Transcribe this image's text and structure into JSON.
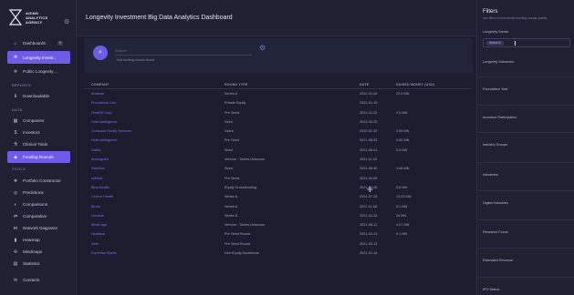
{
  "brand": {
    "name": "AGING ANALYTICS AGENCY"
  },
  "sidebar": {
    "top_items": [
      {
        "label": "Dashboards",
        "badge": "0"
      },
      {
        "label": "Longevity Invest..."
      },
      {
        "label": "Public Longevity ..."
      }
    ],
    "sections": {
      "reports": "REPORTS",
      "data": "DATA",
      "tools": "TOOLS"
    },
    "reports_items": [
      {
        "label": "Downloadable"
      }
    ],
    "data_items": [
      {
        "label": "Companies"
      },
      {
        "label": "Investors"
      },
      {
        "label": "Clinical Trials"
      },
      {
        "label": "Funding Rounds"
      }
    ],
    "tools_items": [
      {
        "label": "Portfolio Constructor"
      },
      {
        "label": "Predictions"
      },
      {
        "label": "Comparisons"
      },
      {
        "label": "Comparative"
      },
      {
        "label": "Network Diagrams"
      },
      {
        "label": "Heatmap"
      },
      {
        "label": "Mindmaps"
      },
      {
        "label": "Statistics"
      }
    ],
    "bottom_item": {
      "label": "Contacts"
    }
  },
  "header": {
    "title": "Longevity Investment Big Data Analytics Dashboard"
  },
  "search": {
    "placeholder": "Search",
    "hint": "Edit funding rounds found"
  },
  "table": {
    "columns": [
      "COMPANY",
      "ROUND TYPE",
      "DATE",
      "RAISED MONEY (USD)"
    ],
    "rows": [
      [
        "Andante",
        "Series A",
        "2022-01-04",
        "22.9 MN"
      ],
      [
        "Providence Gen",
        "Private Equity",
        "2022-01-19",
        ""
      ],
      [
        "OneBIS Corp",
        "Pre Seed",
        "2022-01-02",
        "0.5 MN"
      ],
      [
        "Hoth Intelligence",
        "Seed",
        "2022-02-02",
        ""
      ],
      [
        "Compass Family Services",
        "Grant",
        "2022-01-19",
        "0.05 MN"
      ],
      [
        "Hoth Intelligence",
        "Pre Seed",
        "2021-08-25",
        "0.52 MN"
      ],
      [
        "Gatha",
        "Seed",
        "2021-08-01",
        "0.8 MN"
      ],
      [
        "Arrowgenix",
        "Venture - Series Unknown",
        "2021-11-15",
        ""
      ],
      [
        "Diarrhea",
        "Seed",
        "2021-08-30",
        "1.65 MN"
      ],
      [
        "eMAVA",
        "Pre Seed",
        "2021-04-06",
        ""
      ],
      [
        "Bina Health",
        "Equity Crowdfunding",
        "2021-04-06",
        "0.8 MN"
      ],
      [
        "Cereve Health",
        "Series A",
        "2021-07-28",
        "13.03 MN"
      ],
      [
        "Binda",
        "Series A",
        "2021-11-06",
        "9.1 MN"
      ],
      [
        "Lumada",
        "Series B",
        "2021-02-25",
        "26 MN"
      ],
      [
        "MediLogic",
        "Venture - Series Unknown",
        "2021-08-11",
        "4.07 MN"
      ],
      [
        "Healtase",
        "Pre Seed Round",
        "2021-04-13",
        "0.1 MN"
      ],
      [
        "Selin",
        "Pre Seed Round",
        "2021-03-13",
        ""
      ],
      [
        "Expertise Wants",
        "Non Equity Assistance",
        "2021-01-14",
        ""
      ]
    ]
  },
  "filters": {
    "title": "Filters",
    "subtitle": "Use filters to find needed funding rounds quickly",
    "longevity_sector_label": "Longevity Sector",
    "selected_chip": "Select S",
    "labels": [
      "Longevity Subsector",
      "Foundation Year",
      "Investors Participation",
      "Industry Groups",
      "Industries",
      "Digital Industries",
      "Research Focus",
      "Estimated Revenue",
      "IPO Status"
    ]
  },
  "colors": {
    "accent": "#6c5ce7",
    "background": "#1b1d2e",
    "panel": "#1f2133"
  }
}
